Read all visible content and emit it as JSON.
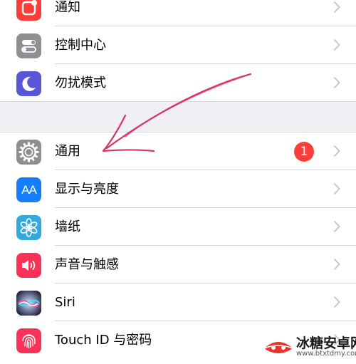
{
  "settings": {
    "group1": [
      {
        "label": "通知",
        "icon": "notifications-icon",
        "color": "#fc3d39"
      },
      {
        "label": "控制中心",
        "icon": "control-center-icon",
        "color": "#8e8e93"
      },
      {
        "label": "勿扰模式",
        "icon": "moon-icon",
        "color": "#5856d6"
      }
    ],
    "group2": [
      {
        "label": "通用",
        "icon": "gear-icon",
        "color": "#8e8e93",
        "badge": "1"
      },
      {
        "label": "显示与亮度",
        "icon": "display-icon",
        "color": "#147efb",
        "icon_text": "AA"
      },
      {
        "label": "墙纸",
        "icon": "wallpaper-icon",
        "color": "#34aadc"
      },
      {
        "label": "声音与触感",
        "icon": "sound-icon",
        "color": "#fc3158"
      },
      {
        "label": "Siri",
        "icon": "siri-icon",
        "color": "#1e1e3f"
      },
      {
        "label": "Touch ID 与密码",
        "icon": "fingerprint-icon",
        "color": "#fc3158"
      }
    ]
  },
  "watermark": {
    "text": "冰糖安卓网",
    "url": "www.btxtdmy.com"
  }
}
